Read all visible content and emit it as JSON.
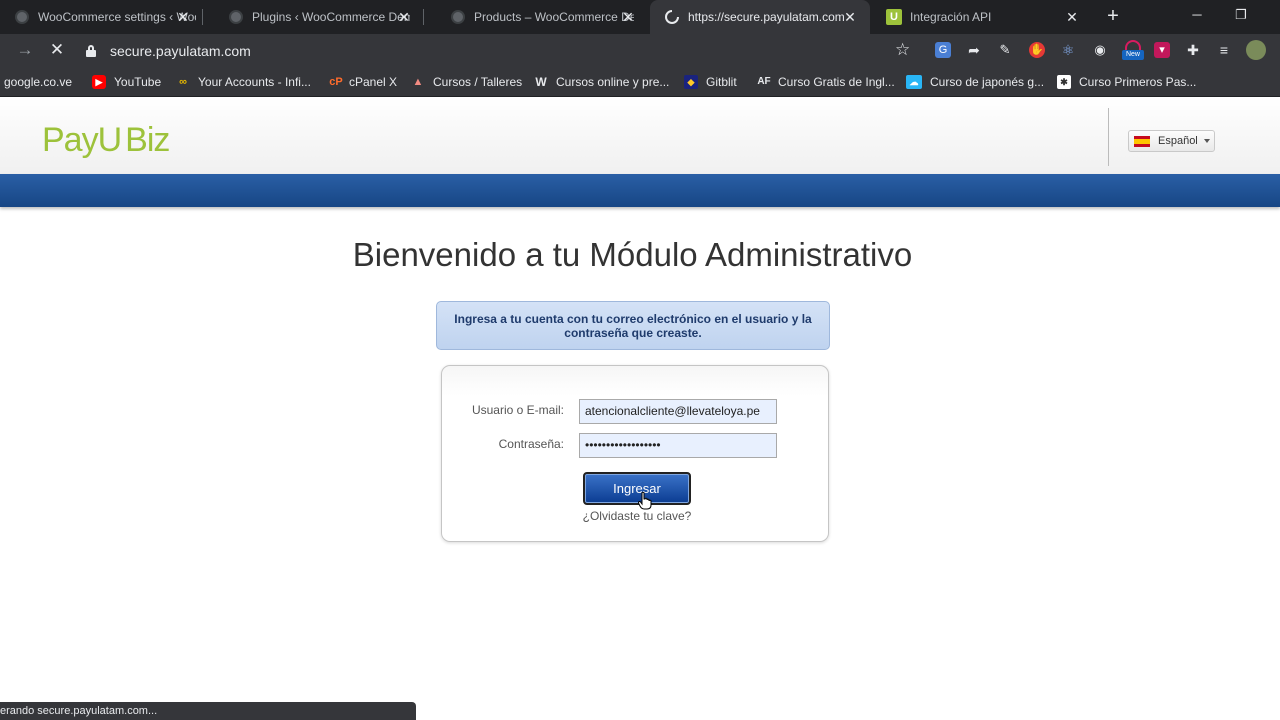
{
  "browser": {
    "tabs": [
      {
        "title": "WooCommerce settings ‹ Woo",
        "active": false
      },
      {
        "title": "Plugins ‹ WooCommerce Demo",
        "active": false
      },
      {
        "title": "Products – WooCommerce Dem",
        "active": false
      },
      {
        "title": "https://secure.payulatam.com",
        "active": true
      },
      {
        "title": "Integración API",
        "active": false
      }
    ],
    "new_tab": "+",
    "minimize": "─",
    "restore": "❐",
    "close_symbol": "✕",
    "address": "secure.payulatam.com",
    "bookmarks": [
      "google.co.ve",
      "YouTube",
      "Your Accounts - Infi...",
      "cPanel X",
      "Cursos / Talleres",
      "Cursos online y pre...",
      "Gitblit",
      "Curso Gratis de Ingl...",
      "Curso de japonés g...",
      "Curso Primeros Pas..."
    ],
    "status_text": "erando secure.payulatam.com...",
    "ext_new_badge": "New"
  },
  "header": {
    "logo_payu": "PayU",
    "logo_biz": "Biz",
    "language": "Español"
  },
  "main": {
    "title": "Bienvenido a tu Módulo Administrativo",
    "info": "Ingresa a tu cuenta con tu correo electrónico en el usuario y la contraseña que creaste.",
    "login": {
      "user_label": "Usuario o E-mail:",
      "user_value": "atencionalcliente@llevateloya.pe",
      "password_label": "Contraseña:",
      "password_value": "••••••••••••••••••",
      "submit": "Ingresar",
      "forgot": "¿Olvidaste tu clave?"
    }
  },
  "colors": {
    "brand_green": "#9dc23b",
    "nav_blue": "#1e4f95",
    "button_blue": "#0b3c91"
  }
}
